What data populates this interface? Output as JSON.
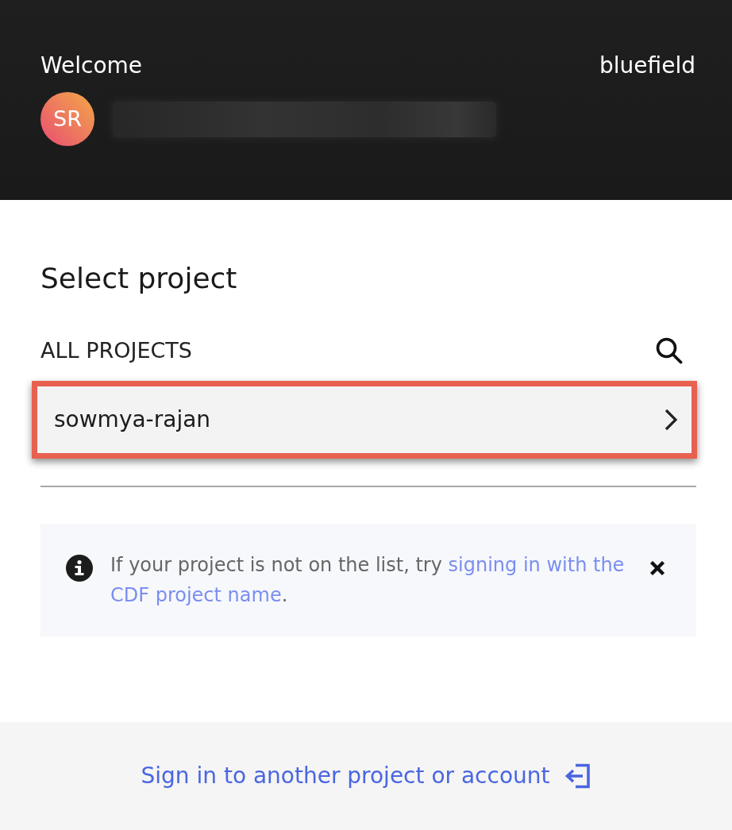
{
  "header": {
    "greeting": "Welcome",
    "organization": "bluefield",
    "user": {
      "initials": "SR"
    }
  },
  "main": {
    "title": "Select project",
    "section_label": "ALL PROJECTS",
    "projects": [
      {
        "name": "sowmya-rajan",
        "highlighted": true
      }
    ],
    "notice": {
      "text": "If your project is not on the list, try ",
      "link_parts": [
        "signing in with the",
        "CDF project name"
      ],
      "after": "."
    }
  },
  "footer": {
    "link": "Sign in to another project or account"
  }
}
